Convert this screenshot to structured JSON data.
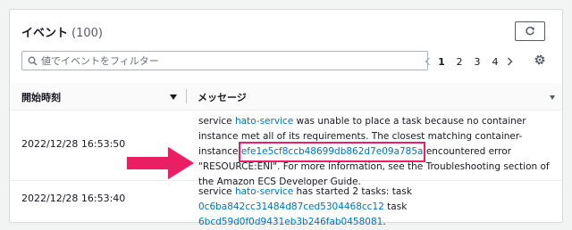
{
  "events": {
    "title": "イベント",
    "count": "(100)"
  },
  "search": {
    "placeholder": "値でイベントをフィルター"
  },
  "pagination": {
    "pages": [
      "1",
      "2",
      "3",
      "4"
    ],
    "current": "1"
  },
  "table": {
    "columns": [
      "開始時刻",
      "メッセージ"
    ],
    "rows": [
      {
        "time": "2022/12/28 16:53:50",
        "msg_prefix": "service ",
        "service": "hato-service",
        "msg_a": " was unable to place a task because no container instance met all of its requirements. The closest matching container-instance ",
        "instance_id": "efe1e5cf8ccb48699db862d7e09a785a",
        "msg_b": " encountered error \"RESOURCE:ENI\". For more information, see the Troubleshooting section of the Amazon ECS Developer Guide."
      },
      {
        "time": "2022/12/28 16:53:40",
        "msg_prefix": "service ",
        "service": "hato-service",
        "msg_a": " has started 2 tasks: task ",
        "task1": "0c6ba842cc31484d87ced5304468cc12",
        "msg_mid": " task ",
        "task2": "6bcd59d0f0d9431eb3b246fab0458081",
        "msg_end": "."
      }
    ]
  },
  "colors": {
    "link": "#0073bb",
    "highlight": "#e91e63"
  },
  "icons": [
    "refresh-icon",
    "search-icon",
    "chevron-left-icon",
    "chevron-right-icon",
    "gear-icon",
    "sort-down-icon",
    "arrow-callout"
  ]
}
